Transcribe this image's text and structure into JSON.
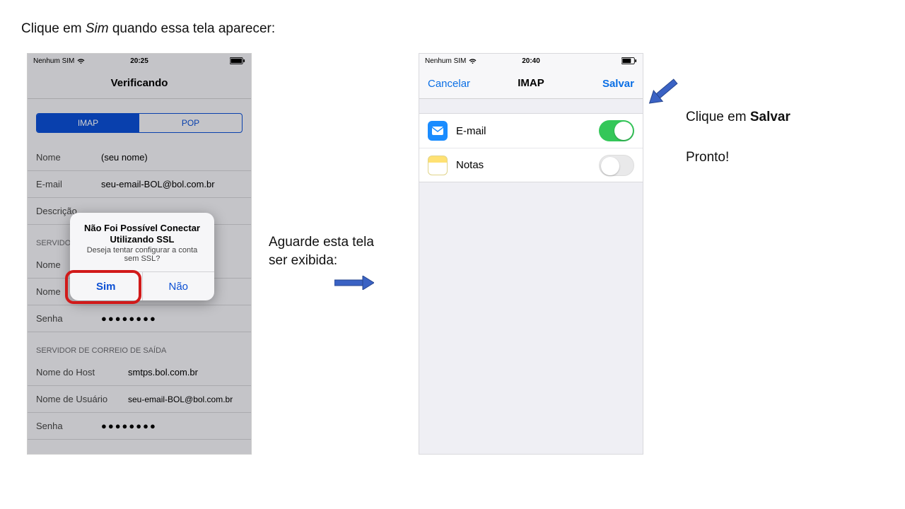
{
  "doc": {
    "top_prefix": "Clique em ",
    "top_italic": "Sim",
    "top_suffix": " quando essa tela aparecer:",
    "mid_line1": "Aguarde esta tela",
    "mid_line2": "ser exibida:",
    "right_prefix": "Clique em ",
    "right_bold": "Salvar",
    "right_done": "Pronto!"
  },
  "left_phone": {
    "carrier": "Nenhum SIM",
    "time": "20:25",
    "nav_title": "Verificando",
    "segmented": {
      "imap": "IMAP",
      "pop": "POP"
    },
    "fields": {
      "nome_label": "Nome",
      "nome_value": "(seu nome)",
      "email_label": "E-mail",
      "email_value": "seu-email-BOL@bol.com.br",
      "descricao_label": "Descrição",
      "incoming_header": "SERVIDOR DE CORREIO DE ENTRADA",
      "incoming_header_short": "SERVIDO",
      "nomehost_in_label": "Nome do Host",
      "nomeuser_in_label": "Nome de Usuário",
      "senha_in_label": "Senha",
      "senha_in_value": "●●●●●●●●",
      "outgoing_header": "SERVIDOR DE CORREIO DE SAÍDA",
      "nomehost_out_label": "Nome do Host",
      "nomehost_out_value": "smtps.bol.com.br",
      "nomeuser_out_label": "Nome de Usuário",
      "nomeuser_out_value": "seu-email-BOL@bol.com.br",
      "senha_out_label": "Senha",
      "senha_out_value": "●●●●●●●●"
    },
    "dialog": {
      "title_l1": "Não Foi Possível Conectar",
      "title_l2": "Utilizando SSL",
      "message": "Deseja tentar configurar a conta sem SSL?",
      "yes": "Sim",
      "no": "Não"
    }
  },
  "right_phone": {
    "carrier": "Nenhum SIM",
    "time": "20:40",
    "nav_left": "Cancelar",
    "nav_title": "IMAP",
    "nav_right": "Salvar",
    "rows": {
      "mail_label": "E-mail",
      "mail_on": true,
      "notes_label": "Notas",
      "notes_on": false
    }
  }
}
